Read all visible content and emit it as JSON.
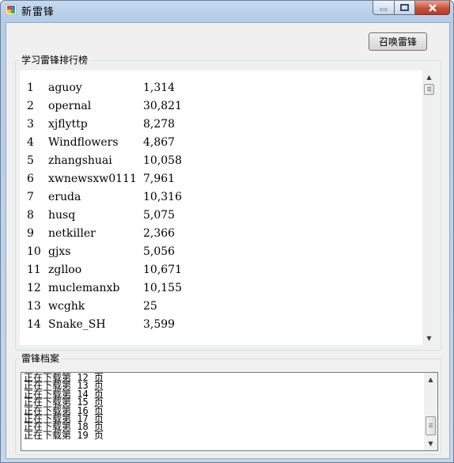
{
  "window": {
    "title": "新雷锋"
  },
  "toolbar": {
    "summon_label": "召唤雷锋"
  },
  "ranking": {
    "label": "学习雷锋排行榜",
    "rows": [
      {
        "rank": "1",
        "name": "aguoy",
        "score": "1,314"
      },
      {
        "rank": "2",
        "name": "opernal",
        "score": "30,821"
      },
      {
        "rank": "3",
        "name": "xjflyttp",
        "score": "8,278"
      },
      {
        "rank": "4",
        "name": "Windflowers",
        "score": "4,867"
      },
      {
        "rank": "5",
        "name": "zhangshuai",
        "score": "10,058"
      },
      {
        "rank": "6",
        "name": "xwnewsxw0111",
        "score": "7,961"
      },
      {
        "rank": "7",
        "name": "eruda",
        "score": "10,316"
      },
      {
        "rank": "8",
        "name": "husq",
        "score": "5,075"
      },
      {
        "rank": "9",
        "name": "netkiller",
        "score": "2,366"
      },
      {
        "rank": "10",
        "name": "gjxs",
        "score": "5,056"
      },
      {
        "rank": "11",
        "name": "zglloo",
        "score": "10,671"
      },
      {
        "rank": "12",
        "name": "muclemanxb",
        "score": "10,155"
      },
      {
        "rank": "13",
        "name": "wcghk",
        "score": "25"
      },
      {
        "rank": "14",
        "name": "Snake_SH",
        "score": "3,599"
      }
    ]
  },
  "archive": {
    "label": "雷锋档案",
    "lines": [
      "正在下载第 12 页",
      "正在下载第 13 页",
      "正在下载第 14 页",
      "正在下载第 15 页",
      "正在下载第 16 页",
      "正在下载第 17 页",
      "正在下载第 18 页",
      "正在下载第 19 页"
    ]
  },
  "icons": {
    "app": "app-icon",
    "minimize": "minimize-icon",
    "maximize": "maximize-icon",
    "close": "close-icon"
  },
  "colors": {
    "titlebar": "#b6cde8",
    "close_button": "#c7503a",
    "client_bg": "#f0f0f0"
  }
}
